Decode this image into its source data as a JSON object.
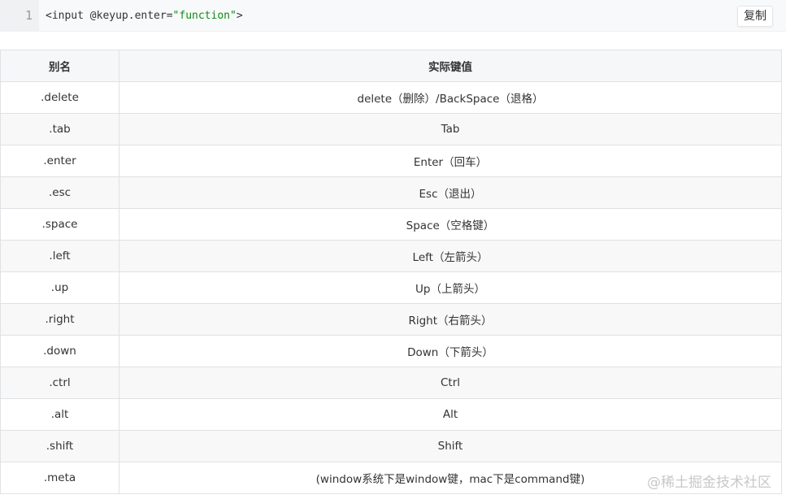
{
  "code_block": {
    "line_number": "1",
    "code_prefix": "<input @keyup.enter=",
    "code_string": "\"function\"",
    "code_suffix": ">",
    "copy_label": "复制"
  },
  "table": {
    "headers": [
      "别名",
      "实际键值"
    ],
    "rows": [
      {
        "alias": ".delete",
        "value": "delete（删除）/BackSpace（退格）"
      },
      {
        "alias": ".tab",
        "value": "Tab"
      },
      {
        "alias": ".enter",
        "value": "Enter（回车）"
      },
      {
        "alias": ".esc",
        "value": "Esc（退出）"
      },
      {
        "alias": ".space",
        "value": "Space（空格键）"
      },
      {
        "alias": ".left",
        "value": "Left（左箭头）"
      },
      {
        "alias": ".up",
        "value": "Up（上箭头）"
      },
      {
        "alias": ".right",
        "value": "Right（右箭头）"
      },
      {
        "alias": ".down",
        "value": "Down（下箭头）"
      },
      {
        "alias": ".ctrl",
        "value": "Ctrl"
      },
      {
        "alias": ".alt",
        "value": "Alt"
      },
      {
        "alias": ".shift",
        "value": "Shift"
      },
      {
        "alias": ".meta",
        "value": "(window系统下是window键，mac下是command键)"
      }
    ]
  },
  "watermark": "@稀土掘金技术社区"
}
